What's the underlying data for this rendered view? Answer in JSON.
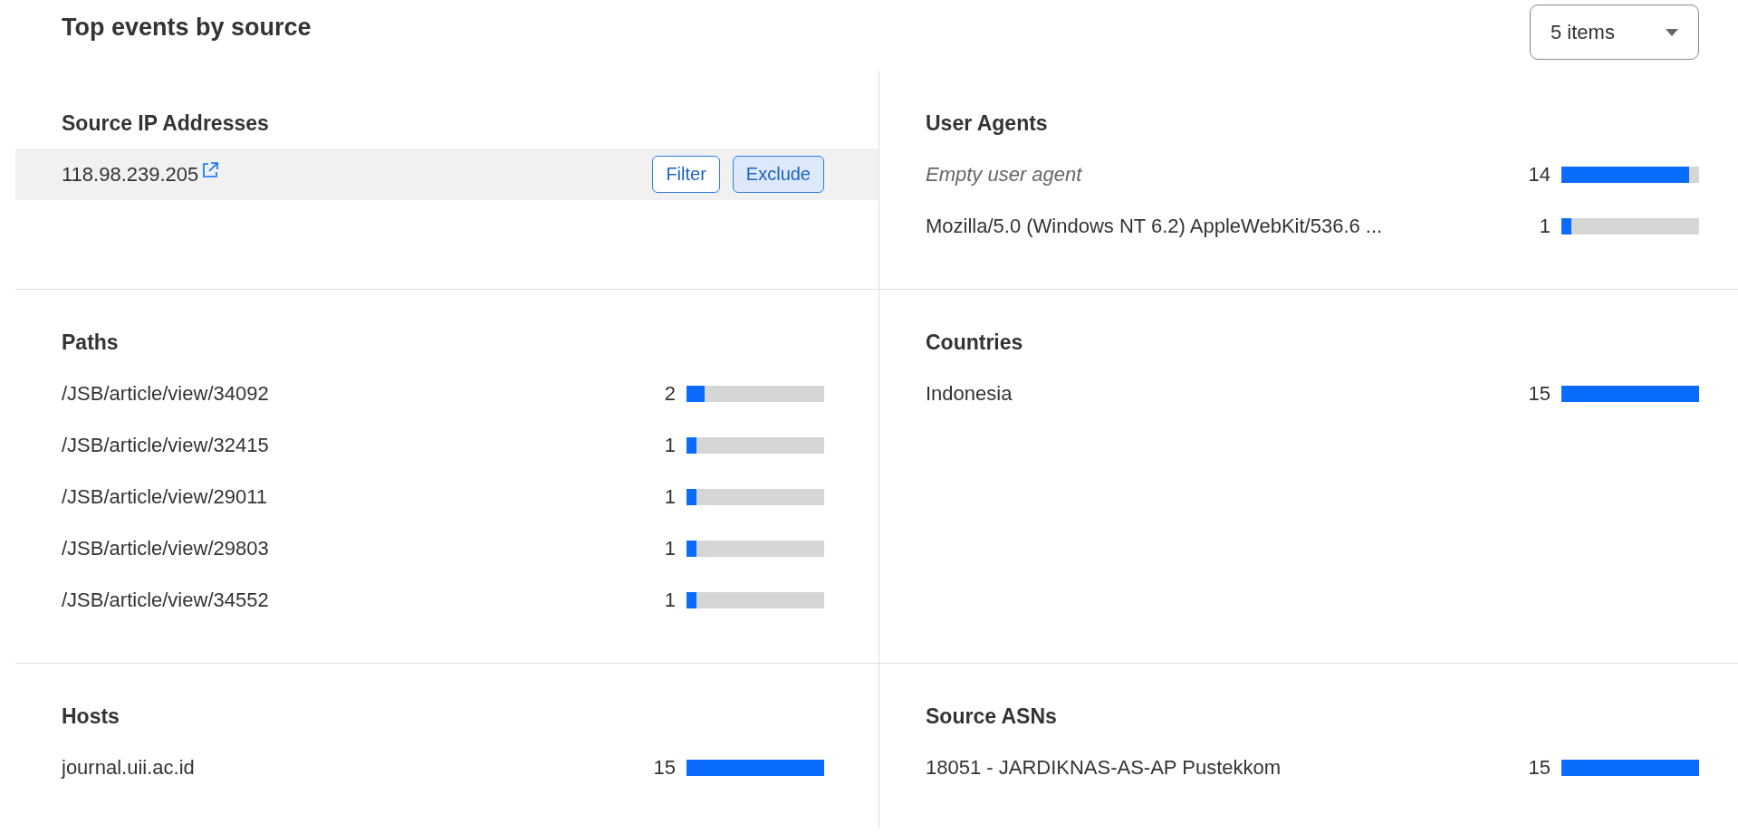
{
  "header": {
    "title": "Top events by source",
    "item_count": {
      "value": "5 items"
    }
  },
  "sections": [
    {
      "title": "Source IP Addresses",
      "items": [
        {
          "kind": "address",
          "label": "118.98.239.205",
          "highlighted": true,
          "actions": [
            {
              "label": "Filter",
              "selected": false
            },
            {
              "label": "Exclude",
              "selected": true
            }
          ]
        }
      ]
    },
    {
      "title": "User Agents",
      "items": [
        {
          "kind": "empty",
          "label": "Empty user agent",
          "count": "14",
          "level": 0.93
        },
        {
          "kind": "bar",
          "label": "Mozilla/5.0 (Windows NT 6.2) AppleWebKit/536.6 ...",
          "count": "1",
          "level": 0.07
        }
      ]
    },
    {
      "title": "Paths",
      "items": [
        {
          "kind": "bar",
          "label": "/JSB/article/view/34092",
          "count": "2",
          "level": 0.13
        },
        {
          "kind": "bar",
          "label": "/JSB/article/view/32415",
          "count": "1",
          "level": 0.07
        },
        {
          "kind": "bar",
          "label": "/JSB/article/view/29011",
          "count": "1",
          "level": 0.07
        },
        {
          "kind": "bar",
          "label": "/JSB/article/view/29803",
          "count": "1",
          "level": 0.07
        },
        {
          "kind": "bar",
          "label": "/JSB/article/view/34552",
          "count": "1",
          "level": 0.07
        }
      ]
    },
    {
      "title": "Countries",
      "items": [
        {
          "kind": "bar",
          "label": "Indonesia",
          "count": "15",
          "level": 1
        }
      ]
    },
    {
      "title": "Hosts",
      "items": [
        {
          "kind": "bar",
          "label": "journal.uii.ac.id",
          "count": "15",
          "level": 1
        }
      ]
    },
    {
      "title": "Source ASNs",
      "items": [
        {
          "kind": "bar",
          "label": "18051 - JARDIKNAS-AS-AP Pustekkom",
          "count": "15",
          "level": 1
        }
      ]
    }
  ]
}
